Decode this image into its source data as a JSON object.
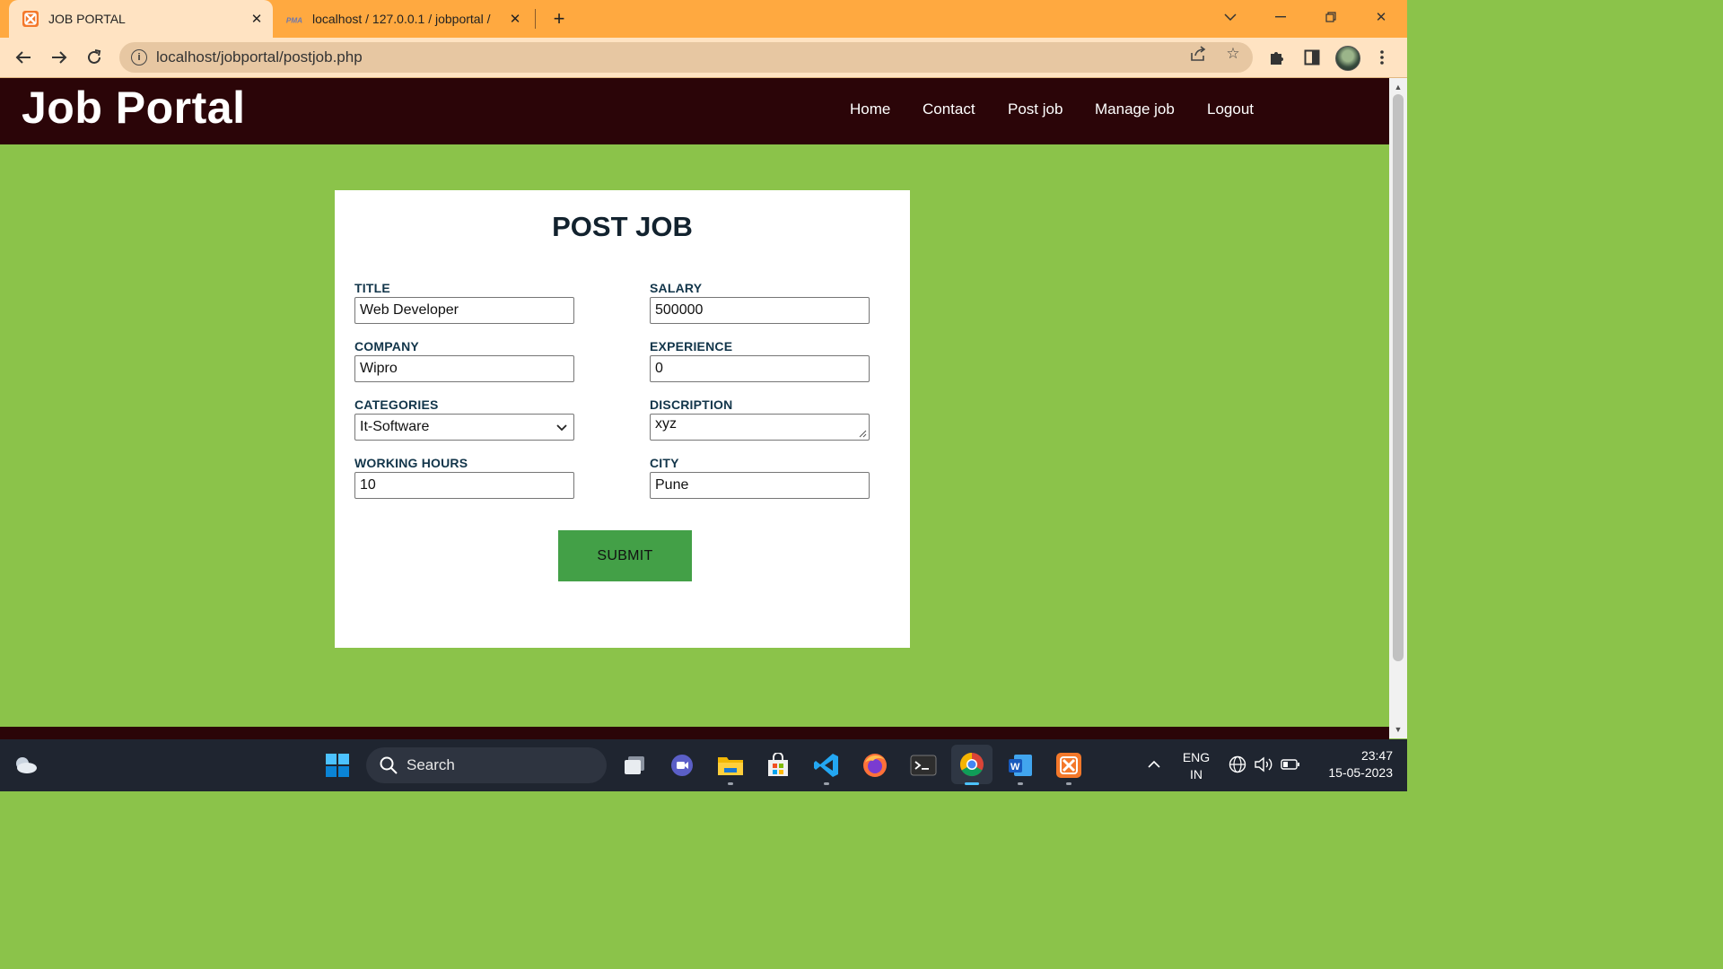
{
  "browser": {
    "tabs": [
      {
        "title": "JOB PORTAL",
        "active": true,
        "favicon": "xampp-icon"
      },
      {
        "title": "localhost / 127.0.0.1 / jobportal /",
        "active": false,
        "favicon": "phpmyadmin-icon"
      }
    ],
    "url": "localhost/jobportal/postjob.php"
  },
  "site": {
    "logo": "Job Portal",
    "nav": [
      "Home",
      "Contact",
      "Post job",
      "Manage job",
      "Logout"
    ]
  },
  "form": {
    "heading": "POST JOB",
    "title_label": "TITLE",
    "title_value": "Web Developer",
    "salary_label": "SALARY",
    "salary_value": "500000",
    "company_label": "COMPANY",
    "company_value": "Wipro",
    "experience_label": "EXPERIENCE",
    "experience_value": "0",
    "categories_label": "CATEGORIES",
    "categories_value": "It-Software",
    "description_label": "DISCRIPTION",
    "description_value": "xyz",
    "hours_label": "WORKING HOURS",
    "hours_value": "10",
    "city_label": "CITY",
    "city_value": "Pune",
    "submit_label": "SUBMIT"
  },
  "taskbar": {
    "search_label": "Search",
    "language_line1": "ENG",
    "language_line2": "IN",
    "time": "23:47",
    "date": "15-05-2023"
  },
  "colors": {
    "page_background": "#8bc34a",
    "header_background": "#2b0508",
    "submit_button": "#43a047",
    "tab_strip": "#ffa940"
  }
}
